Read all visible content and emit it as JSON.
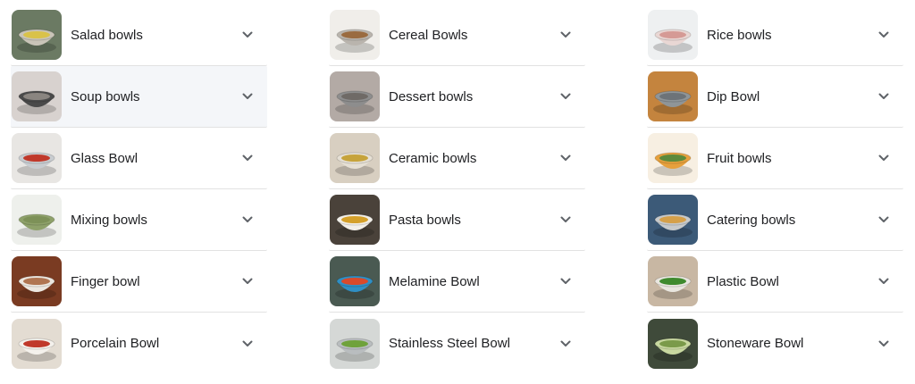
{
  "columns": [
    {
      "items": [
        {
          "label": "Salad bowls",
          "thumb": {
            "bg": "#6b7a63",
            "bowl": "#c9c4b8",
            "food": "#d9c24a"
          }
        },
        {
          "label": "Soup bowls",
          "thumb": {
            "bg": "#d8d2cf",
            "bowl": "#4a4a4a",
            "food": "#8a8580"
          },
          "hover": true
        },
        {
          "label": "Glass Bowl",
          "thumb": {
            "bg": "#e8e6e3",
            "bowl": "#c8ccd0",
            "food": "#c0392b"
          }
        },
        {
          "label": "Mixing bowls",
          "thumb": {
            "bg": "#eef0ec",
            "bowl": "#8ea16a",
            "food": "#7d9158"
          }
        },
        {
          "label": "Finger bowl",
          "thumb": {
            "bg": "#7a3b22",
            "bowl": "#ece7e0",
            "food": "#b07552"
          }
        },
        {
          "label": "Porcelain Bowl",
          "thumb": {
            "bg": "#e3dcd2",
            "bowl": "#f4f1ec",
            "food": "#c0392b"
          }
        }
      ]
    },
    {
      "items": [
        {
          "label": "Cereal Bowls",
          "thumb": {
            "bg": "#f0eeea",
            "bowl": "#b9b4ad",
            "food": "#9a6b40"
          }
        },
        {
          "label": "Dessert bowls",
          "thumb": {
            "bg": "#b3aaa5",
            "bowl": "#8d8d8d",
            "food": "#6f6a66"
          }
        },
        {
          "label": "Ceramic bowls",
          "thumb": {
            "bg": "#d8cfc1",
            "bowl": "#e6e0d5",
            "food": "#c6a33b"
          }
        },
        {
          "label": "Pasta bowls",
          "thumb": {
            "bg": "#4a423a",
            "bowl": "#f2efe9",
            "food": "#d4a02a"
          }
        },
        {
          "label": "Melamine Bowl",
          "thumb": {
            "bg": "#4a5a52",
            "bowl": "#2f8fc4",
            "food": "#d94a2b"
          }
        },
        {
          "label": "Stainless Steel Bowl",
          "thumb": {
            "bg": "#d5d8d6",
            "bowl": "#b9bdbf",
            "food": "#6fa23b"
          }
        }
      ]
    },
    {
      "items": [
        {
          "label": "Rice bowls",
          "thumb": {
            "bg": "#eef0f1",
            "bowl": "#e9d7d4",
            "food": "#d59a95"
          }
        },
        {
          "label": "Dip Bowl",
          "thumb": {
            "bg": "#c4843e",
            "bowl": "#8f9598",
            "food": "#6d7378"
          }
        },
        {
          "label": "Fruit bowls",
          "thumb": {
            "bg": "#f7efe2",
            "bowl": "#e6a03c",
            "food": "#5c8a3b"
          }
        },
        {
          "label": "Catering bowls",
          "thumb": {
            "bg": "#3c5a78",
            "bowl": "#c6c9cb",
            "food": "#d5a04a"
          }
        },
        {
          "label": "Plastic Bowl",
          "thumb": {
            "bg": "#c8b7a3",
            "bowl": "#e9e6df",
            "food": "#3f8a2e"
          }
        },
        {
          "label": "Stoneware Bowl",
          "thumb": {
            "bg": "#3f4a3a",
            "bowl": "#c8d8a0",
            "food": "#7a9a4a"
          }
        }
      ]
    }
  ],
  "colors": {
    "text": "#202124",
    "divider": "#e2e2e2",
    "hover_bg": "#f4f6f9",
    "chevron": "#5f6368"
  },
  "icons": {
    "expand": "chevron-down-icon"
  }
}
